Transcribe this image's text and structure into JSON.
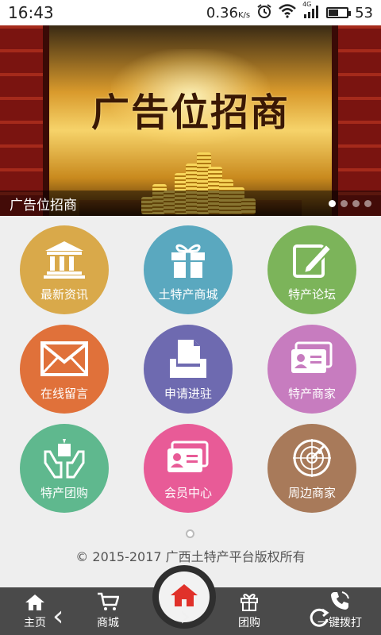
{
  "status_bar": {
    "time": "16:43",
    "net_speed": "0.36",
    "net_speed_unit": "K/s",
    "signal": "4G",
    "battery": "53",
    "battery_level": 0.53
  },
  "banner": {
    "ad_title": "广告位招商",
    "caption": "广告位招商",
    "dots": 4,
    "active_dot": 0
  },
  "grid": [
    {
      "label": "最新资讯",
      "icon": "bank-building-icon",
      "color": "#d9a94a"
    },
    {
      "label": "土特产商城",
      "icon": "gift-box-icon",
      "color": "#5aa8bf"
    },
    {
      "label": "特产论坛",
      "icon": "edit-pencil-icon",
      "color": "#7cb45a"
    },
    {
      "label": "在线留言",
      "icon": "envelope-icon",
      "color": "#e0713a"
    },
    {
      "label": "申请进驻",
      "icon": "document-tray-icon",
      "color": "#6e6ab0"
    },
    {
      "label": "特产商家",
      "icon": "id-card-icon",
      "color": "#c77cbf"
    },
    {
      "label": "特产团购",
      "icon": "hands-box-icon",
      "color": "#5fb88e"
    },
    {
      "label": "会员中心",
      "icon": "member-card-icon",
      "color": "#e85b97"
    },
    {
      "label": "周边商家",
      "icon": "radar-icon",
      "color": "#a87a5a"
    }
  ],
  "copyright": "© 2015-2017 广西土特产平台版权所有",
  "bottom_nav": {
    "home": "主页",
    "mall": "商城",
    "group": "团购",
    "call": "一键拨打"
  }
}
